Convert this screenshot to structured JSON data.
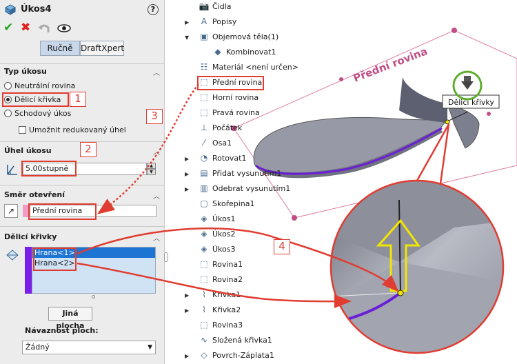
{
  "panel": {
    "title": "Úkos4",
    "help": "?",
    "ok": "✔",
    "cancel": "✖",
    "tabs": [
      "Ručně",
      "DraftXpert"
    ],
    "draft_type": {
      "header": "Typ úkosu",
      "options": [
        "Neutrální rovina",
        "Dělicí křivka",
        "Schodový úkos"
      ],
      "selected": "Dělicí křivka",
      "checkbox": "Umožnit redukovaný úhel"
    },
    "draft_angle": {
      "header": "Úhel úkosu",
      "value": "5.00stupně"
    },
    "pull_direction": {
      "header": "Směr otevření",
      "value": "Přední rovina"
    },
    "parting_lines": {
      "header": "Dělicí křivky",
      "items": [
        "Hrana<1>",
        "Hrana<2>"
      ],
      "other_face_button": "Jiná plocha",
      "face_propagation_label": "Návaznost ploch:",
      "face_propagation_value": "Žádný"
    }
  },
  "tree": [
    {
      "label": "Čidla",
      "icon": "sensor-icon",
      "expand": false
    },
    {
      "label": "Popisy",
      "icon": "annotations-icon",
      "expand": true
    },
    {
      "label": "Objemová těla(1)",
      "icon": "solid-bodies-icon",
      "expand": true,
      "open": true
    },
    {
      "label": "Kombinovat1",
      "icon": "body-icon",
      "expand": false,
      "indent": true
    },
    {
      "label": "Materiál <není určen>",
      "icon": "material-icon",
      "expand": false
    },
    {
      "label": "Přední rovina",
      "icon": "plane-icon",
      "expand": false
    },
    {
      "label": "Horní rovina",
      "icon": "plane-icon",
      "expand": false
    },
    {
      "label": "Pravá rovina",
      "icon": "plane-icon",
      "expand": false
    },
    {
      "label": "Počátek",
      "icon": "origin-icon",
      "expand": false
    },
    {
      "label": "Osa1",
      "icon": "axis-icon",
      "expand": false
    },
    {
      "label": "Rotovat1",
      "icon": "revolve-icon",
      "expand": true
    },
    {
      "label": "Přidat vysunutím1",
      "icon": "extrude-boss-icon",
      "expand": true
    },
    {
      "label": "Odebrat vysunutím1",
      "icon": "extrude-cut-icon",
      "expand": true
    },
    {
      "label": "Skořepina1",
      "icon": "shell-icon",
      "expand": false
    },
    {
      "label": "Úkos1",
      "icon": "draft-icon",
      "expand": false
    },
    {
      "label": "Úkos2",
      "icon": "draft-icon",
      "expand": false
    },
    {
      "label": "Úkos3",
      "icon": "draft-icon",
      "expand": false
    },
    {
      "label": "Rovina1",
      "icon": "plane-icon",
      "expand": false
    },
    {
      "label": "Rovina2",
      "icon": "plane-icon",
      "expand": false
    },
    {
      "label": "Křivka1",
      "icon": "curve-icon",
      "expand": true
    },
    {
      "label": "Křivka2",
      "icon": "curve-icon",
      "expand": true
    },
    {
      "label": "Rovina3",
      "icon": "plane-icon",
      "expand": false
    },
    {
      "label": "Složená křivka1",
      "icon": "composite-curve-icon",
      "expand": false
    },
    {
      "label": "Povrch-Záplata1",
      "icon": "filled-surface-icon",
      "expand": true
    }
  ],
  "viewport": {
    "plane_label": "Přední rovina",
    "tooltip": "Dělicí křivky"
  },
  "callouts": [
    "1",
    "2",
    "3",
    "4"
  ],
  "colors": {
    "callout": "#e03c31",
    "plane": "#e07aa0",
    "edge": "#6a1fd6",
    "arrow": "#f2e600"
  }
}
